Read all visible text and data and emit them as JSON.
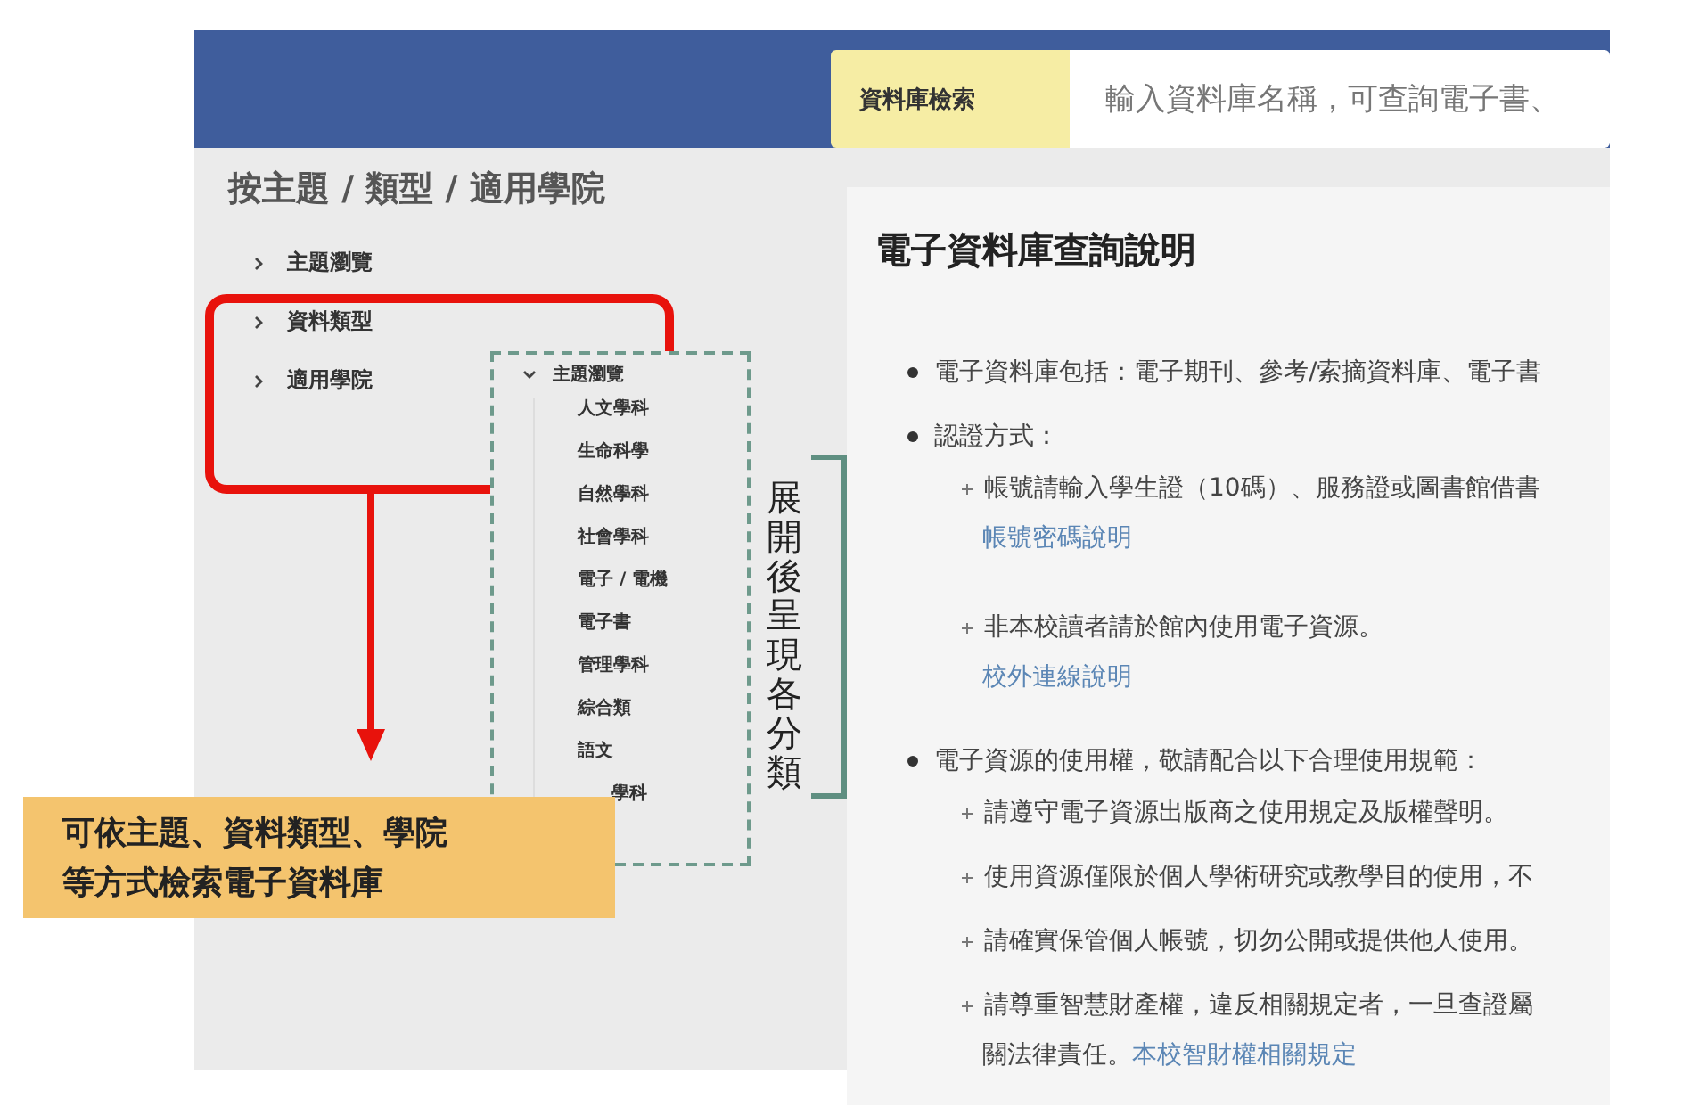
{
  "header": {
    "search_label": "資料庫檢索",
    "search_placeholder": "輸入資料庫名稱，可查詢電子書、"
  },
  "sidebar": {
    "title": "按主題 / 類型 / 適用學院",
    "items": [
      {
        "label": "主題瀏覽",
        "expanded": false
      },
      {
        "label": "資料類型",
        "expanded": false
      },
      {
        "label": "適用學院",
        "expanded": false
      }
    ]
  },
  "content": {
    "title": "電子資料庫查詢說明",
    "bullets": [
      {
        "text": "電子資料庫包括：電子期刊、參考/索摘資料庫、電子書"
      },
      {
        "text": "認證方式：",
        "children": [
          {
            "lines": [
              {
                "text": "帳號請輸入學生證（10碼）、服務證或圖書館借書"
              },
              {
                "link": "帳號密碼說明"
              }
            ]
          },
          {
            "lines": [
              {
                "text": "非本校讀者請於館內使用電子資源。"
              },
              {
                "link": "校外連線說明"
              }
            ]
          }
        ]
      },
      {
        "text": "電子資源的使用權，敬請配合以下合理使用規範：",
        "children": [
          {
            "lines": [
              {
                "text": "請遵守電子資源出版商之使用規定及版權聲明。"
              }
            ]
          },
          {
            "lines": [
              {
                "text": "使用資源僅限於個人學術研究或教學目的使用，不"
              }
            ]
          },
          {
            "lines": [
              {
                "text": "請確實保管個人帳號，切勿公開或提供他人使用。"
              }
            ]
          },
          {
            "lines": [
              {
                "text": "請尊重智慧財產權，違反相關規定者，一旦查證屬"
              },
              {
                "text": "關法律責任。",
                "link": "本校智財權相關規定"
              }
            ]
          }
        ]
      }
    ]
  },
  "annotations": {
    "expanded_tree": {
      "label": "主題瀏覽",
      "expanded": true,
      "children": [
        "人文學科",
        "生命科學",
        "自然學科",
        "社會學科",
        "電子 / 電機",
        "電子書",
        "管理學科",
        "綜合類",
        "語文",
        "學科"
      ]
    },
    "bracket_label": "展開後呈現各分類",
    "callout": [
      "可依主題、資料類型、學院",
      "等方式檢索電子資料庫"
    ]
  }
}
